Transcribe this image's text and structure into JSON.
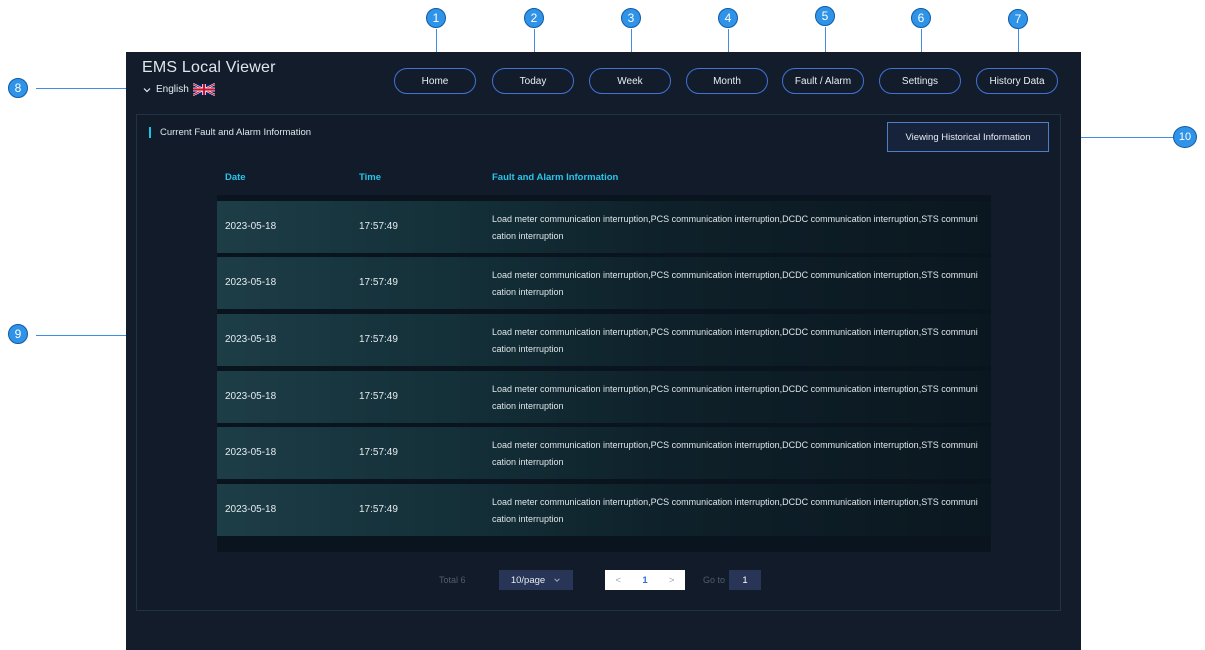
{
  "app": {
    "title": "EMS Local Viewer",
    "language": "English"
  },
  "nav": [
    {
      "label": "Home",
      "callout": "1"
    },
    {
      "label": "Today",
      "callout": "2"
    },
    {
      "label": "Week",
      "callout": "3"
    },
    {
      "label": "Month",
      "callout": "4"
    },
    {
      "label": "Fault / Alarm",
      "callout": "5"
    },
    {
      "label": "Settings",
      "callout": "6"
    },
    {
      "label": "History Data",
      "callout": "7"
    }
  ],
  "callouts": {
    "language": "8",
    "table": "9",
    "history": "10"
  },
  "section_title": "Current Fault and Alarm Information",
  "history_button": "Viewing Historical Information",
  "table": {
    "headers": {
      "date": "Date",
      "time": "Time",
      "info": "Fault and Alarm Information"
    },
    "rows": [
      {
        "date": "2023-05-18",
        "time": "17:57:49",
        "info": "Load meter communication interruption,PCS communication interruption,DCDC communication interruption,STS communication interruption"
      },
      {
        "date": "2023-05-18",
        "time": "17:57:49",
        "info": "Load meter communication interruption,PCS communication interruption,DCDC communication interruption,STS communication interruption"
      },
      {
        "date": "2023-05-18",
        "time": "17:57:49",
        "info": "Load meter communication interruption,PCS communication interruption,DCDC communication interruption,STS communication interruption"
      },
      {
        "date": "2023-05-18",
        "time": "17:57:49",
        "info": "Load meter communication interruption,PCS communication interruption,DCDC communication interruption,STS communication interruption"
      },
      {
        "date": "2023-05-18",
        "time": "17:57:49",
        "info": "Load meter communication interruption,PCS communication interruption,DCDC communication interruption,STS communication interruption"
      },
      {
        "date": "2023-05-18",
        "time": "17:57:49",
        "info": "Load meter communication interruption,PCS communication interruption,DCDC communication interruption,STS communication interruption"
      }
    ]
  },
  "pagination": {
    "total": "Total 6",
    "page_size": "10/page",
    "prev": "<",
    "current": "1",
    "next": ">",
    "goto_label": "Go to",
    "goto_value": "1"
  },
  "colors": {
    "app_background": "#131c2b",
    "nav_border": "#3f73d8",
    "header_text": "#28c5ea",
    "callout": "#2f93e8"
  },
  "icons": {
    "language_toggle": "chevron-down-icon",
    "flag": "uk-flag-icon",
    "page_size_dropdown": "chevron-down-icon"
  }
}
